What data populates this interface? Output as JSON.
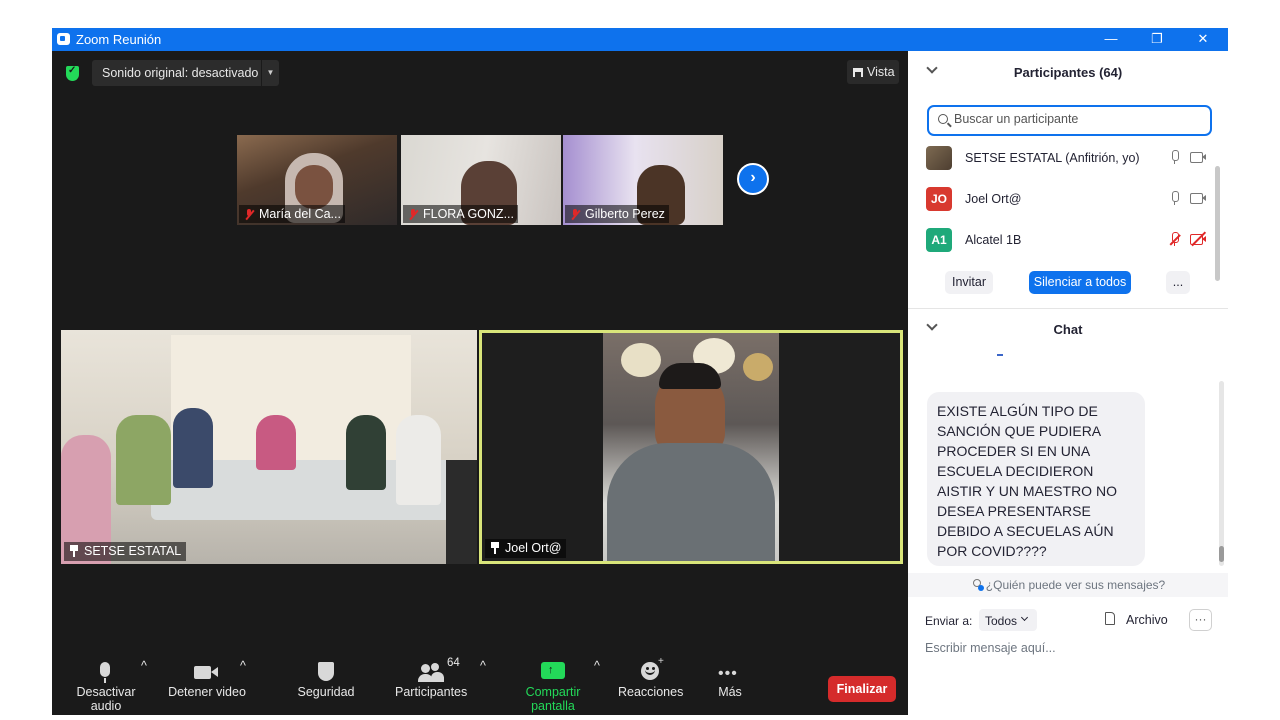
{
  "window": {
    "title": "Zoom Reunión",
    "minimize": "—",
    "restore": "❐",
    "close": "✕"
  },
  "meeting": {
    "sound_label": "Sonido original: desactivado",
    "view_label": "Vista",
    "thumbnails": [
      {
        "name": "María del Ca...",
        "muted": true
      },
      {
        "name": "FLORA GONZ...",
        "muted": true
      },
      {
        "name": "Gilberto Perez",
        "muted": true
      }
    ],
    "next_arrow": "›",
    "main_tiles": [
      {
        "name": "SETSE ESTATAL",
        "pinned": true
      },
      {
        "name": "Joel Ort@",
        "pinned": true,
        "active_speaker": true
      }
    ]
  },
  "toolbar": {
    "audio": "Desactivar audio",
    "video": "Detener video",
    "security": "Seguridad",
    "participants": "Participantes",
    "participants_count": "64",
    "share": "Compartir pantalla",
    "reactions": "Reacciones",
    "more": "Más",
    "end": "Finalizar",
    "caret": "^"
  },
  "participants_panel": {
    "title": "Participantes (64)",
    "search_placeholder": "Buscar un participante",
    "list": [
      {
        "name": "SETSE ESTATAL (Anfitrión, yo)",
        "initials": "",
        "color": "#6b5a45",
        "mic": "on",
        "camera": "on"
      },
      {
        "name": "Joel Ort@",
        "initials": "JO",
        "color": "#d8392f",
        "mic": "on",
        "camera": "on"
      },
      {
        "name": "Alcatel 1B",
        "initials": "A1",
        "color": "#1fa97a",
        "mic": "off",
        "camera": "off"
      }
    ],
    "invite": "Invitar",
    "mute_all": "Silenciar a todos",
    "more": "..."
  },
  "chat": {
    "title": "Chat",
    "message": "EXISTE ALGÚN TIPO DE SANCIÓN QUE PUDIERA PROCEDER SI EN UNA ESCUELA DECIDIERON AISTIR Y UN MAESTRO NO DESEA PRESENTARSE DEBIDO A SECUELAS AÚN POR COVID????",
    "who_can_see": "¿Quién puede ver sus mensajes?",
    "send_to_label": "Enviar a:",
    "send_to_value": "Todos",
    "file_label": "Archivo",
    "more": "···",
    "input_placeholder": "Escribir mensaje aquí..."
  },
  "colors": {
    "zoom_blue": "#0e72ed",
    "meeting_bg": "#1a1a1a",
    "end_red": "#d52b2b",
    "share_green": "#23d959",
    "active_speaker_border": "#d9e57a"
  }
}
